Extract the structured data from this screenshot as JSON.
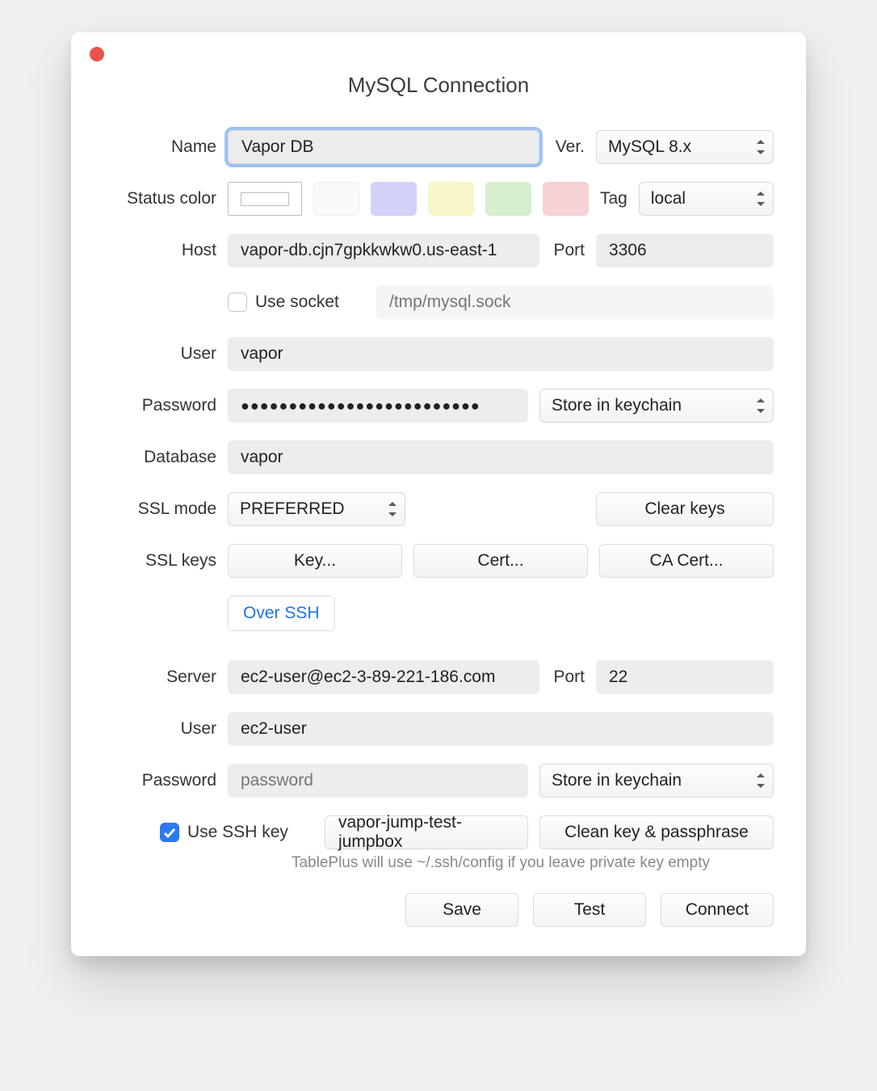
{
  "title": "MySQL Connection",
  "labels": {
    "name": "Name",
    "version": "Ver.",
    "status_color": "Status color",
    "tag": "Tag",
    "host": "Host",
    "port": "Port",
    "use_socket": "Use socket",
    "user": "User",
    "password": "Password",
    "database": "Database",
    "ssl_mode": "SSL mode",
    "ssl_keys": "SSL keys",
    "server": "Server",
    "ssh_port": "Port",
    "ssh_user": "User",
    "ssh_password": "Password",
    "use_ssh_key": "Use SSH key"
  },
  "fields": {
    "name": "Vapor DB",
    "version_selected": "MySQL 8.x",
    "tag_selected": "local",
    "host": "vapor-db.cjn7gpkkwkw0.us-east-1",
    "port": "3306",
    "socket_placeholder": "/tmp/mysql.sock",
    "use_socket_checked": false,
    "user": "vapor",
    "password": "●●●●●●●●●●●●●●●●●●●●●●●●●",
    "password_store": "Store in keychain",
    "database": "vapor",
    "ssl_mode_selected": "PREFERRED",
    "ssh_server": "ec2-user@ec2-3-89-221-186.com",
    "ssh_port": "22",
    "ssh_user": "ec2-user",
    "ssh_password_placeholder": "password",
    "ssh_password_store": "Store in keychain",
    "use_ssh_key_checked": true,
    "ssh_key_name": "vapor-jump-test-jumpbox"
  },
  "status_colors": [
    "#ffffff",
    "#fafafa",
    "#d2d1f8",
    "#f7f6c8",
    "#d6efce",
    "#f5d2d3"
  ],
  "buttons": {
    "clear_keys": "Clear keys",
    "key": "Key...",
    "cert": "Cert...",
    "ca_cert": "CA Cert...",
    "over_ssh": "Over SSH",
    "clean_key": "Clean key & passphrase",
    "save": "Save",
    "test": "Test",
    "connect": "Connect"
  },
  "hint": "TablePlus will use ~/.ssh/config if you leave private key empty"
}
